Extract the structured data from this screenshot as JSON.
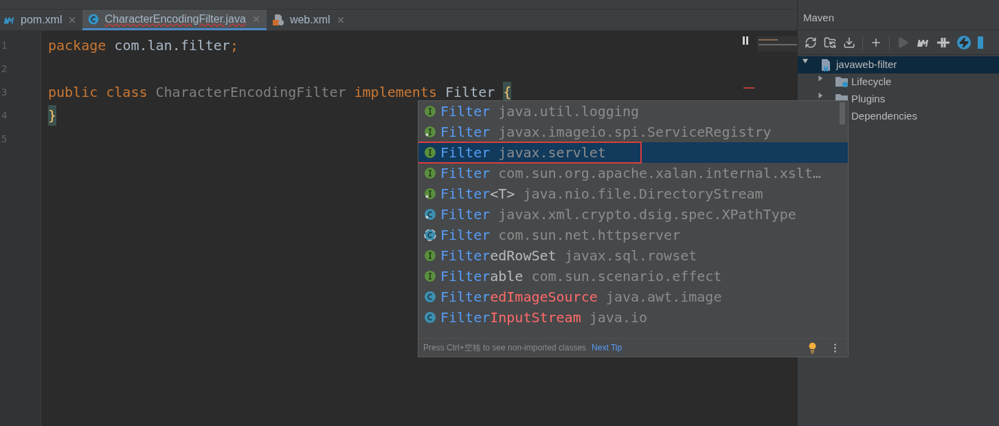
{
  "tabs": [
    {
      "label": "pom.xml",
      "kind": "maven",
      "selected": false
    },
    {
      "label": "CharacterEncodingFilter.java",
      "kind": "class",
      "selected": true
    },
    {
      "label": "web.xml",
      "kind": "xml",
      "selected": false
    }
  ],
  "editor": {
    "lines": [
      {
        "number": "1",
        "tokens": [
          {
            "text": "package",
            "kind": "keyword"
          },
          {
            "text": " com.lan.filter",
            "kind": "plain"
          },
          {
            "text": ";",
            "kind": "keyword"
          }
        ]
      },
      {
        "number": "2"
      },
      {
        "number": "3",
        "tokens": [
          {
            "text": "public class",
            "kind": "keyword"
          },
          {
            "text": " CharacterEncodingFilter ",
            "kind": "unused"
          },
          {
            "text": "implements",
            "kind": "keyword"
          },
          {
            "text": " Filter ",
            "kind": "plain"
          },
          {
            "text": "{",
            "kind": "brace"
          }
        ]
      },
      {
        "number": "4",
        "tokens": [
          {
            "text": "}",
            "kind": "brace"
          }
        ]
      },
      {
        "number": "5"
      }
    ]
  },
  "completion": {
    "items": [
      {
        "kind": "interface",
        "library": false,
        "match": "Filter",
        "package": "java.util.logging",
        "selected": false
      },
      {
        "kind": "interface",
        "library": true,
        "match": "Filter",
        "package": "javax.imageio.spi.ServiceRegistry",
        "selected": false
      },
      {
        "kind": "interface",
        "library": false,
        "match": "Filter",
        "package": "javax.servlet",
        "selected": true
      },
      {
        "kind": "interface",
        "library": false,
        "match": "Filter",
        "package": "com.sun.org.apache.xalan.internal.xslt…",
        "selected": false
      },
      {
        "kind": "interface",
        "library": true,
        "match": "Filter",
        "rest": "<T>",
        "rest_error": false,
        "package": "java.nio.file.DirectoryStream",
        "selected": false
      },
      {
        "kind": "class",
        "library": true,
        "match": "Filter",
        "package": "javax.xml.crypto.dsig.spec.XPathType",
        "selected": false
      },
      {
        "kind": "abstract",
        "library": false,
        "match": "Filter",
        "package": "com.sun.net.httpserver",
        "selected": false
      },
      {
        "kind": "interface",
        "library": false,
        "match": "Filter",
        "rest": "edRowSet",
        "rest_error": false,
        "package": "javax.sql.rowset",
        "selected": false
      },
      {
        "kind": "interface",
        "library": false,
        "match": "Filter",
        "rest": "able",
        "rest_error": false,
        "package": "com.sun.scenario.effect",
        "selected": false
      },
      {
        "kind": "class",
        "library": false,
        "match": "Filter",
        "rest": "edImageSource",
        "rest_error": true,
        "package": "java.awt.image",
        "selected": false
      },
      {
        "kind": "class",
        "library": false,
        "match": "Filter",
        "rest": "InputStream",
        "rest_error": true,
        "package": "java.io",
        "selected": false
      }
    ],
    "hint": "Press Ctrl+空格 to see non-imported classes",
    "next_tip": "Next Tip"
  },
  "maven": {
    "title": "Maven",
    "tree": [
      {
        "label": "javaweb-filter",
        "expanded": true,
        "selected": true,
        "children": [
          {
            "label": "Lifecycle",
            "expanded": false,
            "selected": false
          },
          {
            "label": "Plugins",
            "expanded": false,
            "selected": false
          },
          {
            "label": "Dependencies",
            "selected": false
          }
        ]
      }
    ]
  }
}
